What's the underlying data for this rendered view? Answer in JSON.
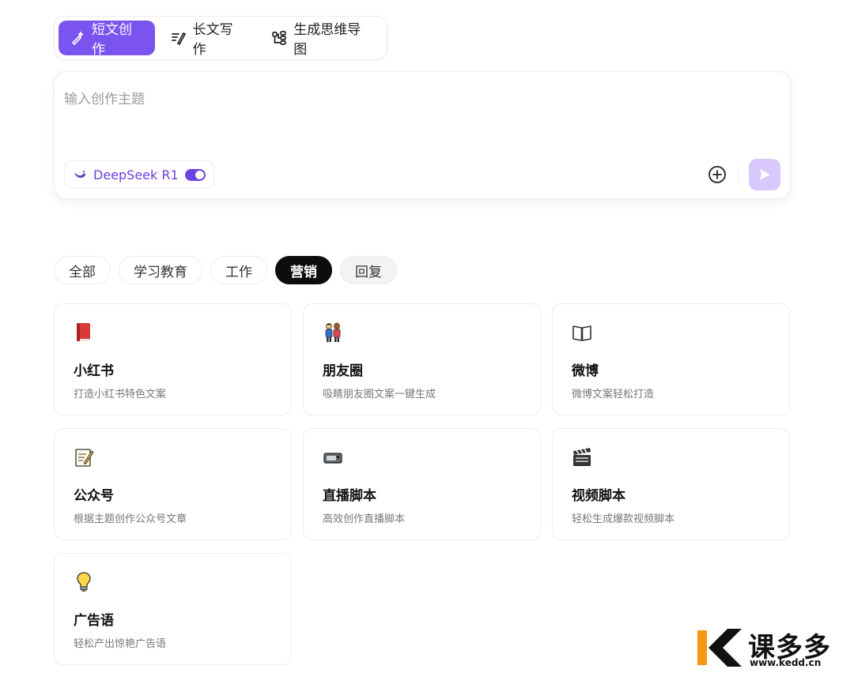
{
  "mode_tabs": [
    {
      "label": "短文创作",
      "icon": "sparkle-pen-icon",
      "active": true
    },
    {
      "label": "长文写作",
      "icon": "lines-pen-icon",
      "active": false
    },
    {
      "label": "生成思维导图",
      "icon": "mindmap-icon",
      "active": false
    }
  ],
  "prompt": {
    "placeholder": "输入创作主题",
    "model_label": "DeepSeek R1",
    "model_enabled": true
  },
  "categories": [
    {
      "label": "全部",
      "state": "default"
    },
    {
      "label": "学习教育",
      "state": "default"
    },
    {
      "label": "工作",
      "state": "default"
    },
    {
      "label": "营销",
      "state": "active"
    },
    {
      "label": "回复",
      "state": "hover"
    }
  ],
  "cards": [
    {
      "title": "小红书",
      "desc": "打造小红书特色文案",
      "icon": "red-book-icon"
    },
    {
      "title": "朋友圈",
      "desc": "吸睛朋友圈文案一键生成",
      "icon": "friends-icon"
    },
    {
      "title": "微博",
      "desc": "微博文案轻松打造",
      "icon": "open-book-icon"
    },
    {
      "title": "公众号",
      "desc": "根据主题创作公众号文章",
      "icon": "memo-icon"
    },
    {
      "title": "直播脚本",
      "desc": "高效创作直播脚本",
      "icon": "video-camera-icon"
    },
    {
      "title": "视频脚本",
      "desc": "轻松生成爆款视频脚本",
      "icon": "clapperboard-icon"
    },
    {
      "title": "广告语",
      "desc": "轻松产出惊艳广告语",
      "icon": "lightbulb-icon"
    }
  ],
  "watermark": {
    "text": "课多多",
    "url": "www.kedd.cn"
  },
  "colors": {
    "accent": "#7b54f0",
    "accent_light": "#d9c8fb",
    "active_chip": "#0d0d0d"
  }
}
